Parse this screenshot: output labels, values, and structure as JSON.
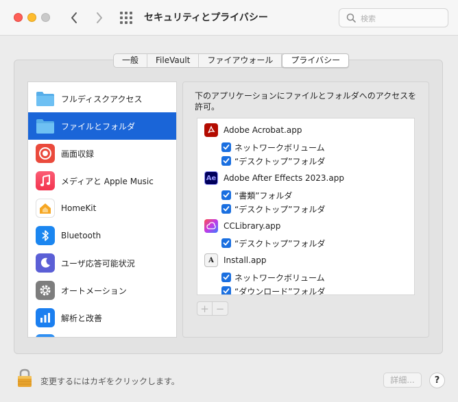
{
  "window": {
    "title": "セキュリティとプライバシー"
  },
  "search": {
    "placeholder": "検索"
  },
  "tabs": [
    {
      "label": "一般"
    },
    {
      "label": "FileVault"
    },
    {
      "label": "ファイアウォール"
    },
    {
      "label": "プライバシー",
      "active": true
    }
  ],
  "sidebar": {
    "items": [
      {
        "label": "フルディスクアクセス",
        "icon": "folder-icon"
      },
      {
        "label": "ファイルとフォルダ",
        "icon": "folder-icon",
        "selected": true
      },
      {
        "label": "画面収録",
        "icon": "screen-record-icon"
      },
      {
        "label": "メディアと Apple Music",
        "icon": "music-icon"
      },
      {
        "label": "HomeKit",
        "icon": "home-icon"
      },
      {
        "label": "Bluetooth",
        "icon": "bluetooth-icon"
      },
      {
        "label": "ユーザ応答可能状況",
        "icon": "moon-icon"
      },
      {
        "label": "オートメーション",
        "icon": "gear-icon"
      },
      {
        "label": "解析と改善",
        "icon": "bar-chart-icon"
      }
    ]
  },
  "main": {
    "description": "下のアプリケーションにファイルとフォルダへのアクセスを許可。",
    "apps": [
      {
        "name": "Adobe Acrobat.app",
        "icon": "acrobat-icon",
        "permissions": [
          {
            "label": "ネットワークボリューム",
            "checked": true
          },
          {
            "label": "“デスクトップ”フォルダ",
            "checked": true
          }
        ]
      },
      {
        "name": "Adobe After Effects 2023.app",
        "icon": "after-effects-icon",
        "icon_text": "Ae",
        "permissions": [
          {
            "label": "“書類”フォルダ",
            "checked": true
          },
          {
            "label": "“デスクトップ”フォルダ",
            "checked": true
          }
        ]
      },
      {
        "name": "CCLibrary.app",
        "icon": "creative-cloud-icon",
        "permissions": [
          {
            "label": "“デスクトップ”フォルダ",
            "checked": true
          }
        ]
      },
      {
        "name": "Install.app",
        "icon": "adobe-installer-icon",
        "icon_text": "A",
        "permissions": [
          {
            "label": "ネットワークボリューム",
            "checked": true
          },
          {
            "label": "“ダウンロード”フォルダ",
            "checked": true
          }
        ]
      }
    ],
    "add_label": "+",
    "remove_label": "−"
  },
  "footer": {
    "lock_text": "変更するにはカギをクリックします。",
    "details_label": "詳細...",
    "help_label": "?"
  },
  "colors": {
    "accent": "#1a65d8",
    "checkbox": "#1a6fe0"
  }
}
